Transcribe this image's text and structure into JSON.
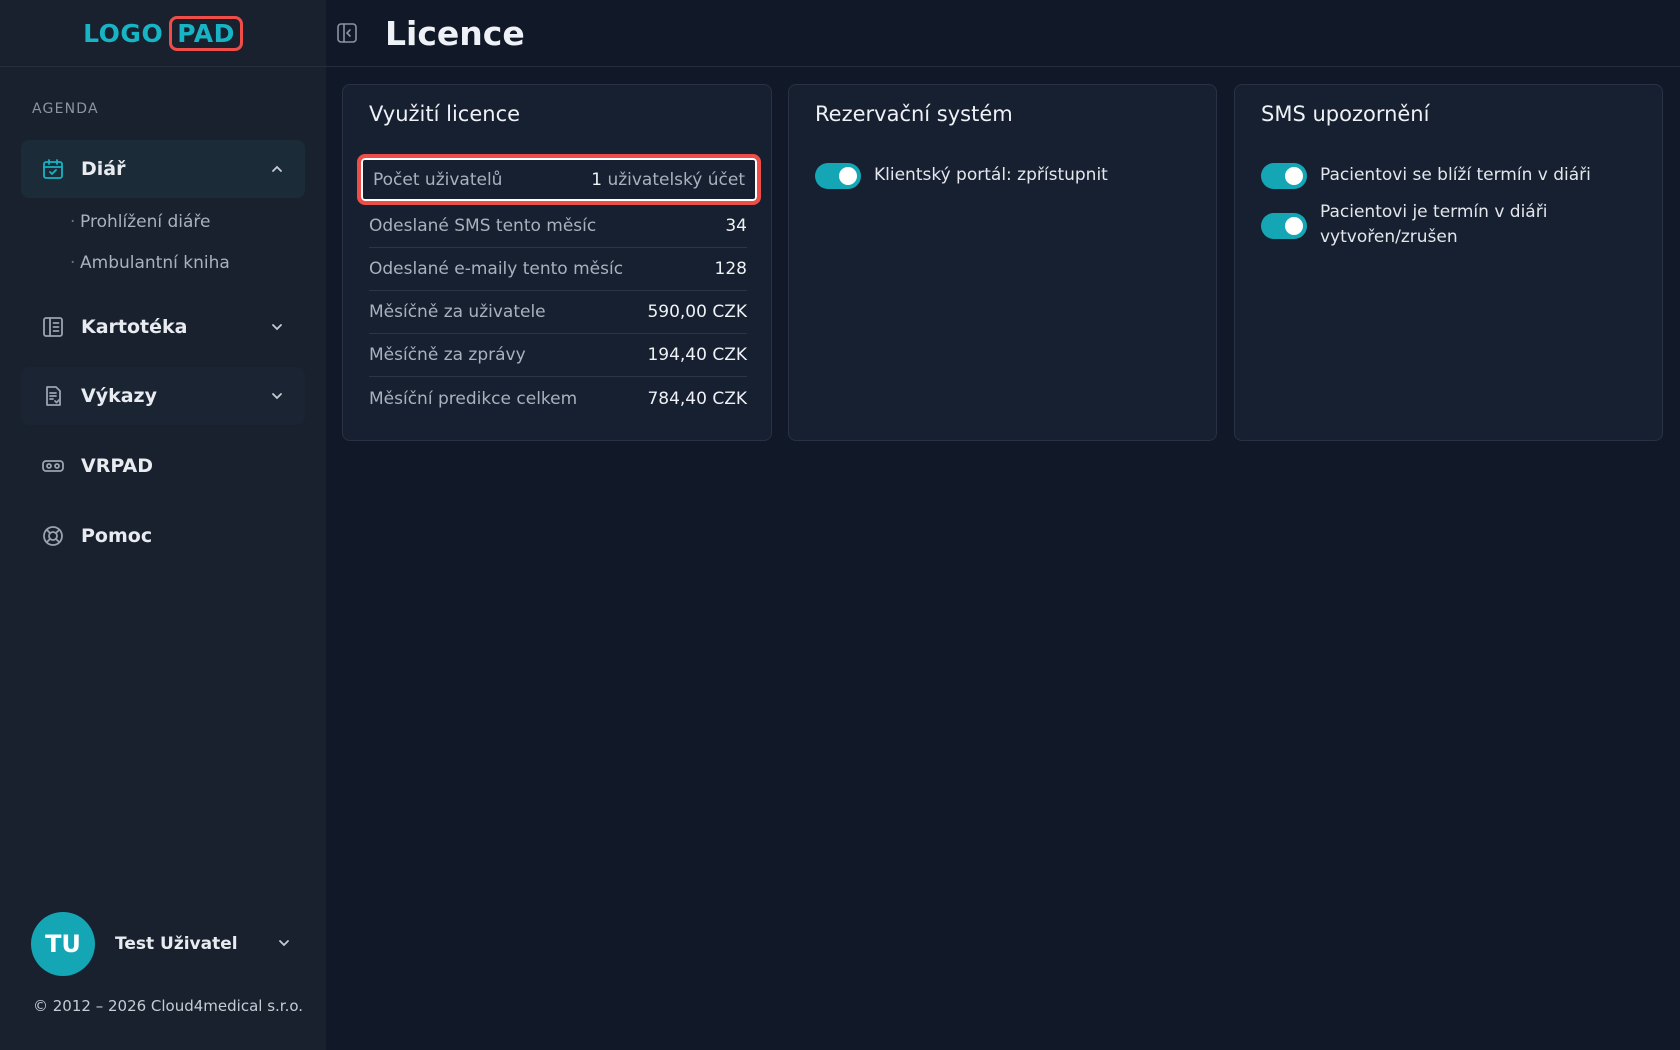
{
  "logo": {
    "part1": "LOGO",
    "part2": "PAD"
  },
  "sidebar": {
    "section": "AGENDA",
    "items": [
      {
        "label": "Diář",
        "icon": "calendar-check-icon",
        "expanded": true,
        "subitems": [
          "Prohlížení diáře",
          "Ambulantní kniha"
        ]
      },
      {
        "label": "Kartotéka",
        "icon": "book-icon",
        "expanded": false
      },
      {
        "label": "Výkazy",
        "icon": "report-icon",
        "expanded": false
      },
      {
        "label": "VRPAD",
        "icon": "vr-headset-icon"
      },
      {
        "label": "Pomoc",
        "icon": "lifebuoy-icon"
      }
    ]
  },
  "user": {
    "initials": "TU",
    "name": "Test Uživatel"
  },
  "copyright": "© 2012 – 2026 Cloud4medical s.r.o.",
  "header": {
    "title": "Licence"
  },
  "cards": {
    "licence": {
      "title": "Využití licence",
      "rows": [
        {
          "label": "Počet uživatelů",
          "value_num": "1",
          "value_text": "uživatelský účet"
        },
        {
          "label": "Odeslané SMS tento měsíc",
          "value": "34"
        },
        {
          "label": "Odeslané e-maily tento měsíc",
          "value": "128"
        },
        {
          "label": "Měsíčně za uživatele",
          "value": "590,00 CZK"
        },
        {
          "label": "Měsíčně za zprávy",
          "value": "194,40 CZK"
        },
        {
          "label": "Měsíční predikce celkem",
          "value": "784,40 CZK"
        }
      ]
    },
    "reservation": {
      "title": "Rezervační systém",
      "toggles": [
        {
          "label": "Klientský portál: zpřístupnit",
          "on": true
        }
      ]
    },
    "sms": {
      "title": "SMS upozornění",
      "toggles": [
        {
          "label": "Pacientovi se blíží termín v diáři",
          "on": true
        },
        {
          "label": "Pacientovi je termín v diáři vytvořen/zrušen",
          "on": true
        }
      ]
    }
  },
  "colors": {
    "accent": "#14a6b5",
    "highlight": "#ef4d48",
    "background": "#111827",
    "sidebar": "#19212f"
  }
}
